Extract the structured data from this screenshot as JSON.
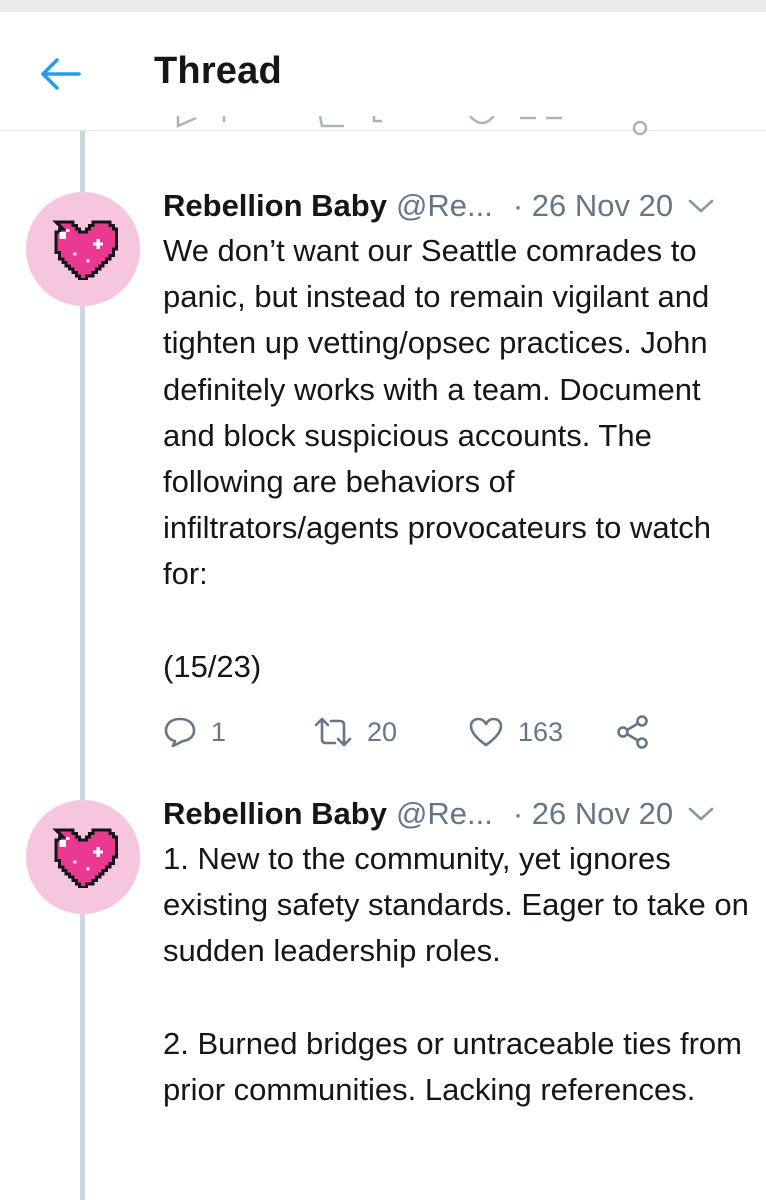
{
  "header": {
    "title": "Thread",
    "back_icon": "arrow-left-icon",
    "accent_color": "#1da1f2"
  },
  "tweets": [
    {
      "display_name": "Rebellion Baby",
      "handle": "@Re...",
      "date": "· 26 Nov 20",
      "avatar_icon": "pixel-heart-icon",
      "paragraphs": [
        "We don’t want our Seattle comrades to panic, but instead to remain vigilant and tighten up vetting/opsec practices.  John definitely works with a team. Document and block suspicious accounts. The following are behaviors of infiltrators/agents provocateurs to watch for:",
        "(15/23)"
      ],
      "replies": "1",
      "retweets": "20",
      "likes": "163"
    },
    {
      "display_name": "Rebellion Baby",
      "handle": "@Re...",
      "date": "· 26 Nov 20",
      "avatar_icon": "pixel-heart-icon",
      "paragraphs": [
        "1. New to the community, yet ignores existing safety standards. Eager to take on sudden leadership roles.",
        "2. Burned bridges or untraceable ties from prior communities. Lacking references."
      ]
    }
  ],
  "colors": {
    "text": "#14171a",
    "secondary_text": "#657786",
    "thread_line": "#ccd6dd",
    "avatar_bg": "#f6c6de",
    "heart_pink": "#e8388f"
  }
}
